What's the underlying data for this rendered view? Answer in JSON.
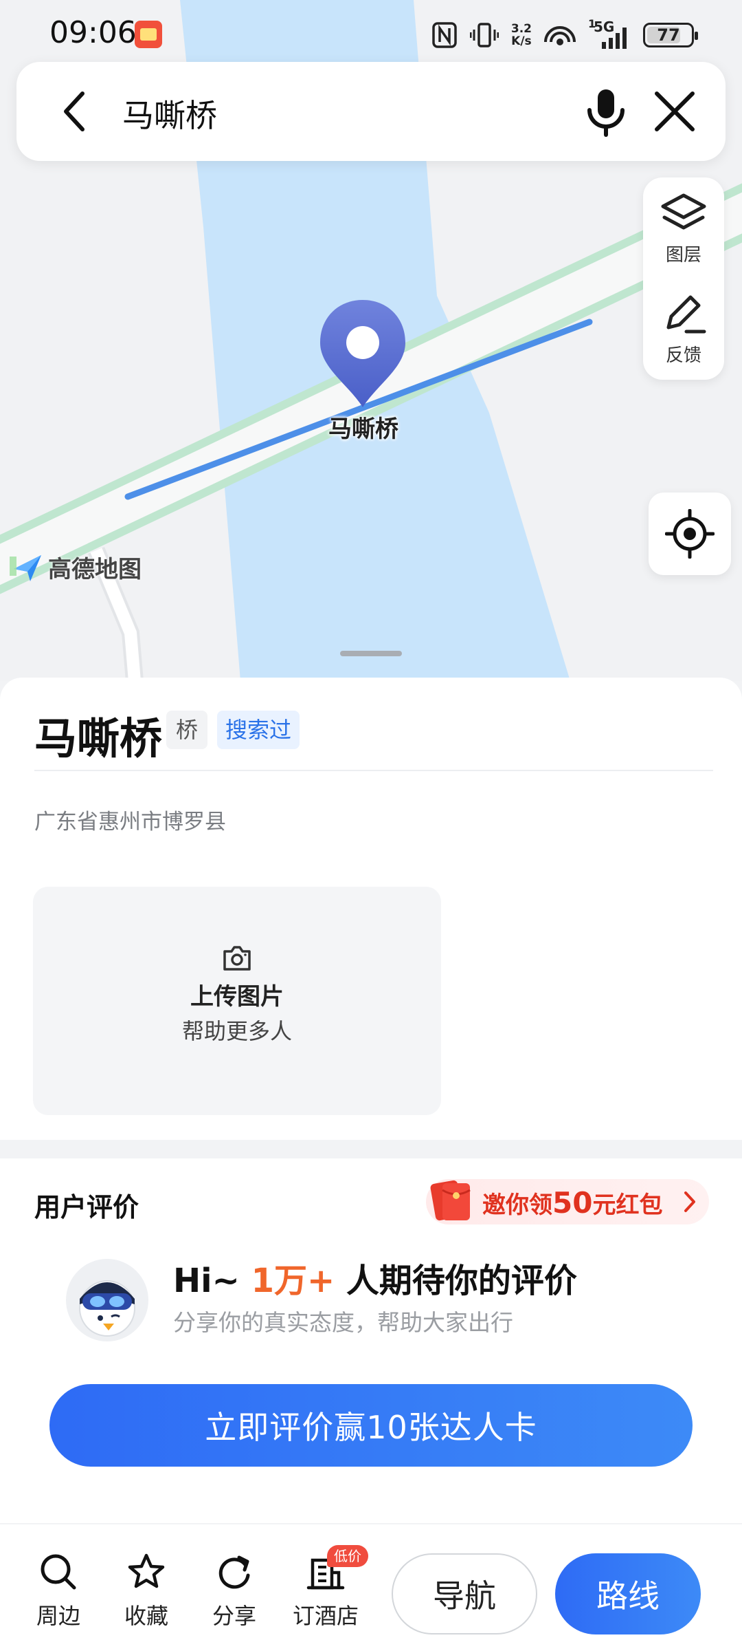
{
  "status_bar": {
    "time": "09:06",
    "speed_top": "3.2",
    "speed_bottom": "K/s",
    "sim_index": "1",
    "network": "5G",
    "battery": "77"
  },
  "search": {
    "query": "马嘶桥"
  },
  "map": {
    "pin_label": "马嘶桥",
    "logo_text": "高德地图",
    "layer_label": "图层",
    "feedback_label": "反馈",
    "colors": {
      "river": "#c8e4fb",
      "road_edge": "#bfe6cf",
      "route_line": "#4d8fe8",
      "pin": "#5a6fd0"
    }
  },
  "poi": {
    "name": "马嘶桥",
    "category_tag": "桥",
    "history_tag": "搜索过",
    "address": "广东省惠州市博罗县",
    "upload_title": "上传图片",
    "upload_subtitle": "帮助更多人"
  },
  "reviews": {
    "title": "用户评价",
    "promo_prefix": "邀你领",
    "promo_amount": "50",
    "promo_suffix": "元红包",
    "headline_prefix": "Hi~ ",
    "headline_highlight": "1万+",
    "headline_suffix": " 人期待你的评价",
    "subline": "分享你的真实态度，帮助大家出行",
    "cta_label": "立即评价赢10张达人卡"
  },
  "bottom_bar": {
    "items": [
      {
        "label": "周边",
        "icon": "search-icon"
      },
      {
        "label": "收藏",
        "icon": "star-icon"
      },
      {
        "label": "分享",
        "icon": "share-icon"
      },
      {
        "label": "订酒店",
        "icon": "hotel-icon",
        "badge": "低价"
      }
    ],
    "navigate_label": "导航",
    "route_label": "路线"
  }
}
